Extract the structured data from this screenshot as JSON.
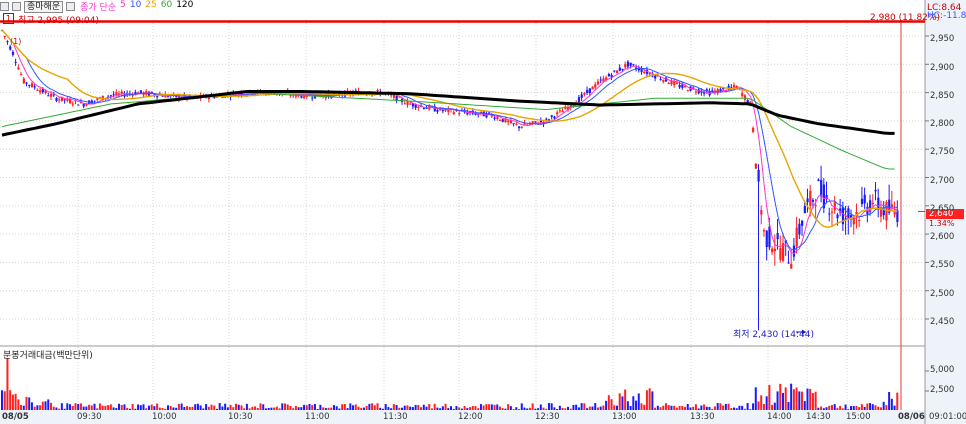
{
  "toolbar": {
    "title_tab": "종마해운",
    "ma_label": "종가 단순",
    "ma_periods": [
      "5",
      "10",
      "25",
      "60",
      "120"
    ]
  },
  "annotations": {
    "high": "최고 2,995 (09:04)",
    "high_badge": "1",
    "low": "최저 2,430 (14:44)",
    "ref_line": "2,980 (11.82%)",
    "lc": "LC:8.64",
    "hc": "HC:-11.85",
    "current_price": "2,640",
    "current_pct": "1.34%",
    "small_marker": "(1)"
  },
  "volume_panel": {
    "title": "분봉거래대금(백만단위)"
  },
  "colors": {
    "up": "#ff2020",
    "down": "#1a1aff",
    "ma5": "#ff33cc",
    "ma10": "#3355ff",
    "ma25": "#e8a400",
    "ma60": "#33aa33",
    "ma120": "#000000",
    "resistance": "#ee0000"
  },
  "chart_data": {
    "type": "candlestick",
    "price_axis": {
      "ticks": [
        "2,950",
        "2,900",
        "2,850",
        "2,800",
        "2,750",
        "2,700",
        "2,650",
        "2,600",
        "2,550",
        "2,500",
        "2,450"
      ],
      "min": 2400,
      "max": 2980
    },
    "volume_axis": {
      "ticks": [
        "5,000",
        "2,500"
      ]
    },
    "time_axis": [
      "08/05",
      "09:30",
      "10:00",
      "10:30",
      "11:00",
      "11:30",
      "12:00",
      "12:30",
      "13:00",
      "13:30",
      "14:00",
      "14:30",
      "15:00",
      "08/06",
      "09:01:00"
    ],
    "resistance_price": 2980,
    "current_price": 2640,
    "low_price": 2430,
    "price_path": [
      [
        0,
        2960
      ],
      [
        4,
        2920
      ],
      [
        8,
        2870
      ],
      [
        12,
        2860
      ],
      [
        20,
        2840
      ],
      [
        30,
        2830
      ],
      [
        40,
        2845
      ],
      [
        50,
        2850
      ],
      [
        60,
        2845
      ],
      [
        70,
        2840
      ],
      [
        80,
        2845
      ],
      [
        90,
        2850
      ],
      [
        100,
        2850
      ],
      [
        110,
        2845
      ],
      [
        120,
        2845
      ],
      [
        130,
        2850
      ],
      [
        140,
        2850
      ],
      [
        150,
        2830
      ],
      [
        160,
        2820
      ],
      [
        170,
        2815
      ],
      [
        180,
        2810
      ],
      [
        190,
        2790
      ],
      [
        200,
        2800
      ],
      [
        210,
        2830
      ],
      [
        220,
        2870
      ],
      [
        230,
        2900
      ],
      [
        240,
        2880
      ],
      [
        250,
        2860
      ],
      [
        260,
        2850
      ],
      [
        270,
        2860
      ],
      [
        275,
        2830
      ],
      [
        280,
        2600
      ],
      [
        285,
        2580
      ],
      [
        290,
        2560
      ],
      [
        295,
        2640
      ],
      [
        300,
        2680
      ],
      [
        305,
        2650
      ],
      [
        310,
        2630
      ],
      [
        315,
        2640
      ],
      [
        320,
        2660
      ],
      [
        325,
        2640
      ]
    ],
    "ma120_path": [
      [
        0,
        2775
      ],
      [
        20,
        2795
      ],
      [
        50,
        2830
      ],
      [
        90,
        2852
      ],
      [
        110,
        2852
      ],
      [
        150,
        2848
      ],
      [
        190,
        2835
      ],
      [
        220,
        2828
      ],
      [
        260,
        2832
      ],
      [
        275,
        2830
      ],
      [
        285,
        2810
      ],
      [
        300,
        2795
      ],
      [
        325,
        2778
      ]
    ],
    "ma60_path": [
      [
        0,
        2790
      ],
      [
        40,
        2830
      ],
      [
        90,
        2850
      ],
      [
        150,
        2835
      ],
      [
        200,
        2820
      ],
      [
        240,
        2840
      ],
      [
        275,
        2840
      ],
      [
        290,
        2790
      ],
      [
        310,
        2745
      ],
      [
        325,
        2715
      ]
    ],
    "volume_series": "per-candle trade value (백만), relative heights estimated"
  }
}
